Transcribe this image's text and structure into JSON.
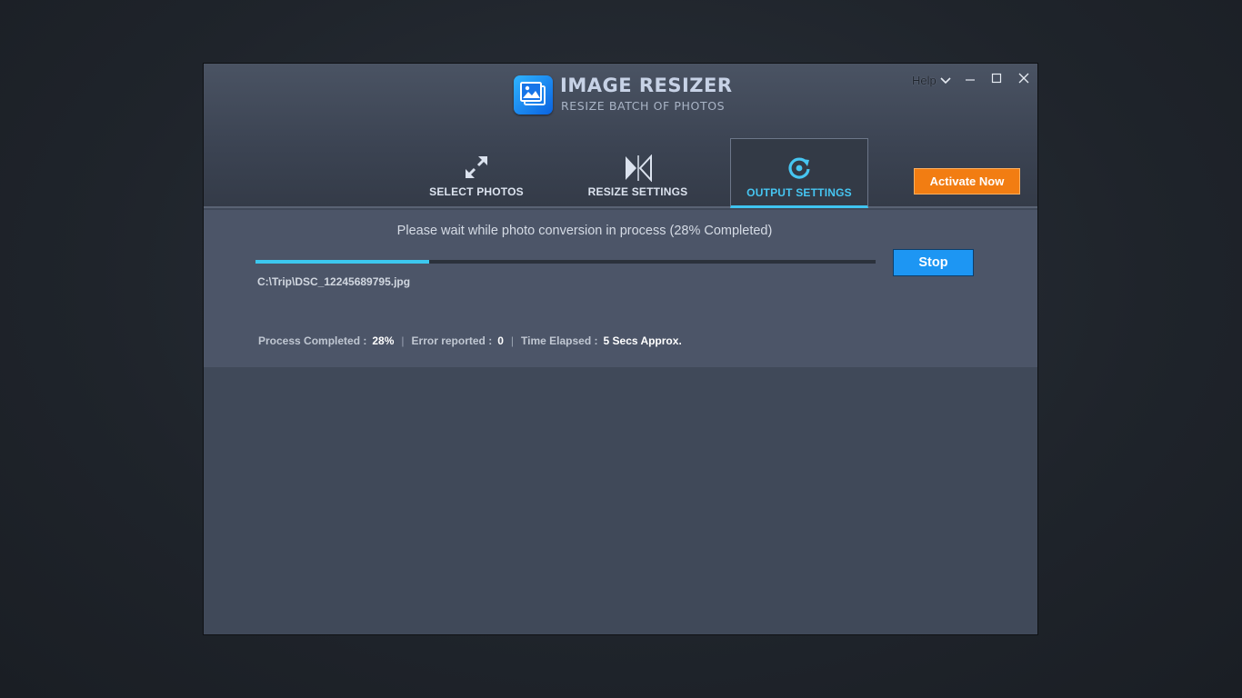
{
  "app": {
    "title": "IMAGE RESIZER",
    "subtitle": "RESIZE BATCH OF PHOTOS"
  },
  "window_controls": {
    "help_label": "Help"
  },
  "tabs": [
    {
      "label": "SELECT PHOTOS",
      "icon": "expand-arrows-icon",
      "active": false
    },
    {
      "label": "RESIZE SETTINGS",
      "icon": "resize-bowtie-icon",
      "active": false
    },
    {
      "label": "OUTPUT SETTINGS",
      "icon": "refresh-icon",
      "active": true
    }
  ],
  "activate_label": "Activate Now",
  "progress": {
    "status_text": "Please wait while photo conversion in process  (28% Completed)",
    "fraction": 0.28,
    "stop_label": "Stop",
    "current_file": "C:\\Trip\\DSC_12245689795.jpg"
  },
  "stats": {
    "process_label": "Process Completed :",
    "process_value": "28%",
    "error_label": "Error reported :",
    "error_value": "0",
    "time_label": "Time Elapsed :",
    "time_value": "5 Secs  Approx."
  },
  "colors": {
    "accent": "#3cc8ef",
    "activate": "#f27d12",
    "stop": "#1d96f3"
  }
}
